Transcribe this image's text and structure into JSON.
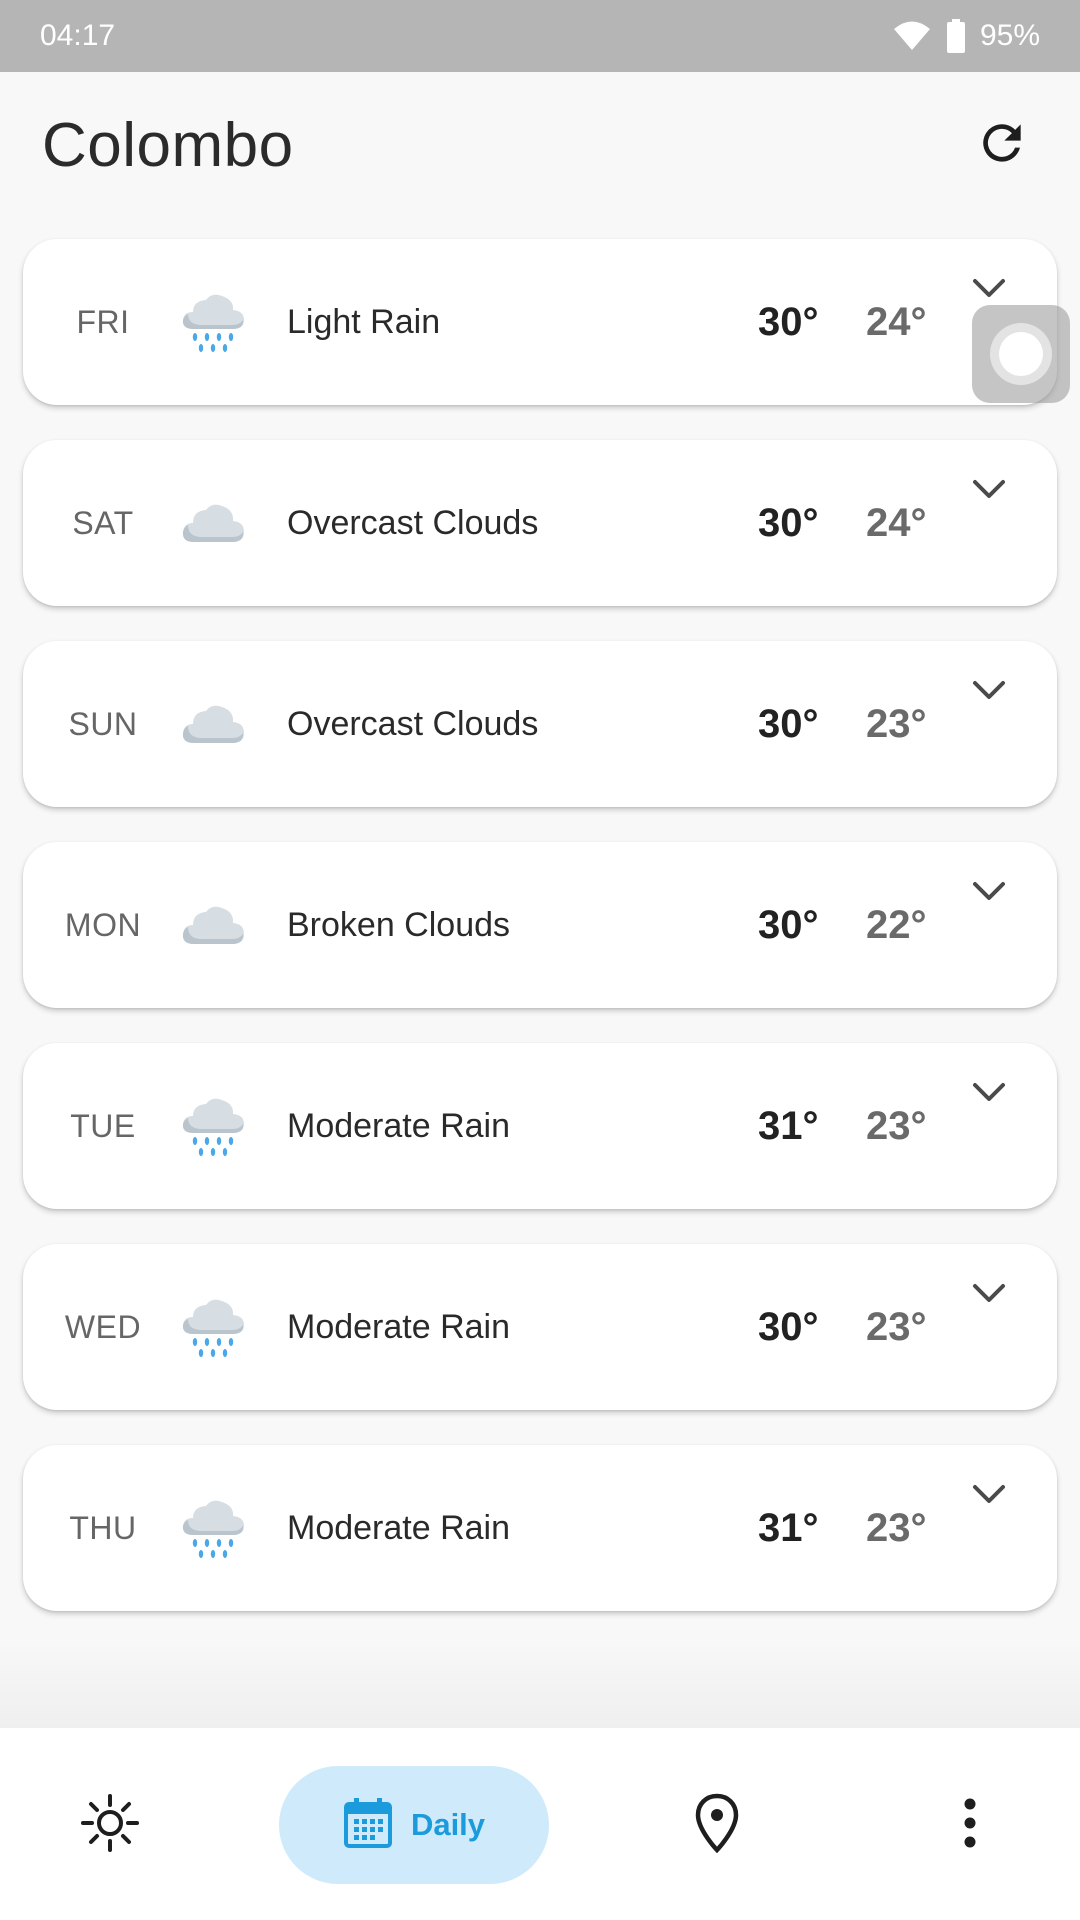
{
  "status_bar": {
    "time": "04:17",
    "battery": "95%",
    "icons": [
      "wifi-icon",
      "battery-icon"
    ]
  },
  "header": {
    "city": "Colombo",
    "refresh_icon": "refresh-icon"
  },
  "forecast": [
    {
      "day": "FRI",
      "icon": "rain-cloud-icon",
      "condition": "Light Rain",
      "high": "30°",
      "low": "24°"
    },
    {
      "day": "SAT",
      "icon": "cloud-icon",
      "condition": "Overcast Clouds",
      "high": "30°",
      "low": "24°"
    },
    {
      "day": "SUN",
      "icon": "cloud-icon",
      "condition": "Overcast Clouds",
      "high": "30°",
      "low": "23°"
    },
    {
      "day": "MON",
      "icon": "cloud-icon",
      "condition": "Broken Clouds",
      "high": "30°",
      "low": "22°"
    },
    {
      "day": "TUE",
      "icon": "rain-cloud-icon",
      "condition": "Moderate Rain",
      "high": "31°",
      "low": "23°"
    },
    {
      "day": "WED",
      "icon": "rain-cloud-icon",
      "condition": "Moderate Rain",
      "high": "30°",
      "low": "23°"
    },
    {
      "day": "THU",
      "icon": "rain-cloud-icon",
      "condition": "Moderate Rain",
      "high": "31°",
      "low": "23°"
    }
  ],
  "bottom_nav": {
    "items": [
      {
        "icon": "sun-icon",
        "label": ""
      },
      {
        "icon": "calendar-icon",
        "label": "Daily",
        "selected": true
      },
      {
        "icon": "location-pin-icon",
        "label": ""
      },
      {
        "icon": "more-vert-icon",
        "label": ""
      }
    ]
  },
  "colors": {
    "accent": "#1b9bdb",
    "accent_bg": "#cfeafb",
    "status_bar": "#b5b5b5",
    "background": "#f8f8f8"
  }
}
